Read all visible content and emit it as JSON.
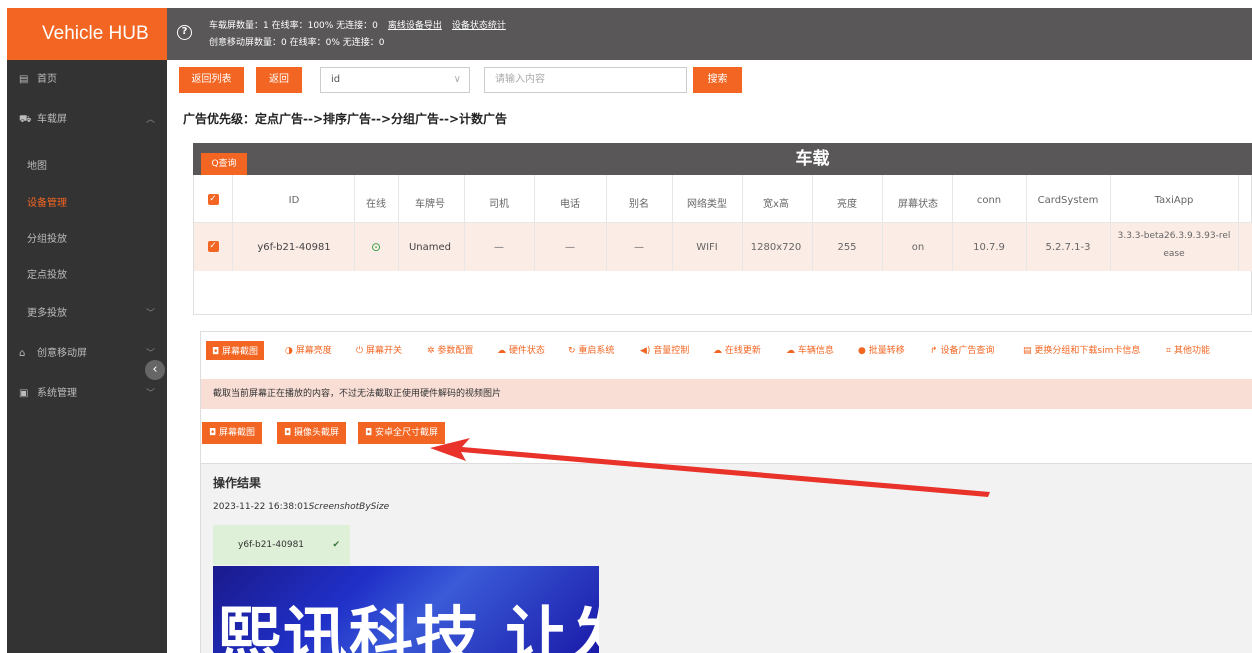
{
  "header": {
    "brand": "Vehicle HUB",
    "help_icon": "?",
    "stats_line1": "车载屏数量：1 在线率：100% 无连接：0",
    "export_link": "离线设备导出",
    "stats_link": "设备状态统计",
    "stats_line2": "创意移动屏数量：0 在线率：0% 无连接：0"
  },
  "sidebar": {
    "items": [
      {
        "label": "首页",
        "icon": "home-icon"
      },
      {
        "label": "车载屏",
        "icon": "car-icon"
      },
      {
        "label": "地图"
      },
      {
        "label": "设备管理"
      },
      {
        "label": "分组投放"
      },
      {
        "label": "定点投放"
      },
      {
        "label": "更多投放"
      },
      {
        "label": "创意移动屏",
        "icon": "bank-icon"
      },
      {
        "label": "系统管理",
        "icon": "settings-icon"
      }
    ],
    "active_color": "#f26522"
  },
  "toolbar": {
    "back_list": "返回列表",
    "back": "返回",
    "select_value": "id",
    "search_placeholder": "请输入内容",
    "search_button": "搜索"
  },
  "priority_text": "广告优先级：定点广告-->排序广告-->分组广告-->计数广告",
  "table": {
    "title": "车载",
    "query_button": "Q查询",
    "columns": [
      "ID",
      "在线",
      "车牌号",
      "司机",
      "电话",
      "别名",
      "网络类型",
      "宽x高",
      "亮度",
      "屏幕状态",
      "conn",
      "CardSystem",
      "TaxiApp"
    ],
    "row": [
      "y6f-b21-40981",
      "Unamed",
      "—",
      "—",
      "—",
      "WIFI",
      "1280x720",
      "255",
      "on",
      "10.7.9",
      "5.2.7.1-3",
      "3.3.3-beta26.3.9.3.93-rel",
      "ease"
    ]
  },
  "tools": {
    "items": [
      "屏幕截图",
      "屏幕亮度",
      "屏幕开关",
      "参数配置",
      "硬件状态",
      "重启系统",
      "音量控制",
      "在线更新",
      "车辆信息",
      "批量转移",
      "设备广告查询",
      "更换分组和下载sim卡信息",
      "其他功能"
    ]
  },
  "notice": "截取当前屏幕正在播放的内容，不过无法截取正使用硬件解码的视频图片",
  "screenshot_buttons": [
    "屏幕截图",
    "摄像头截屏",
    "安卓全尺寸截屏"
  ],
  "result": {
    "title": "操作结果",
    "time": "2023-11-22 16:38:01",
    "method": "ScreenshotBySize",
    "device": "y6f-b21-40981",
    "image_text": "熙讯科技 让发布更简单"
  },
  "colors": {
    "accent": "#f26522",
    "topbar": "#595757",
    "sidebar": "#333333"
  }
}
